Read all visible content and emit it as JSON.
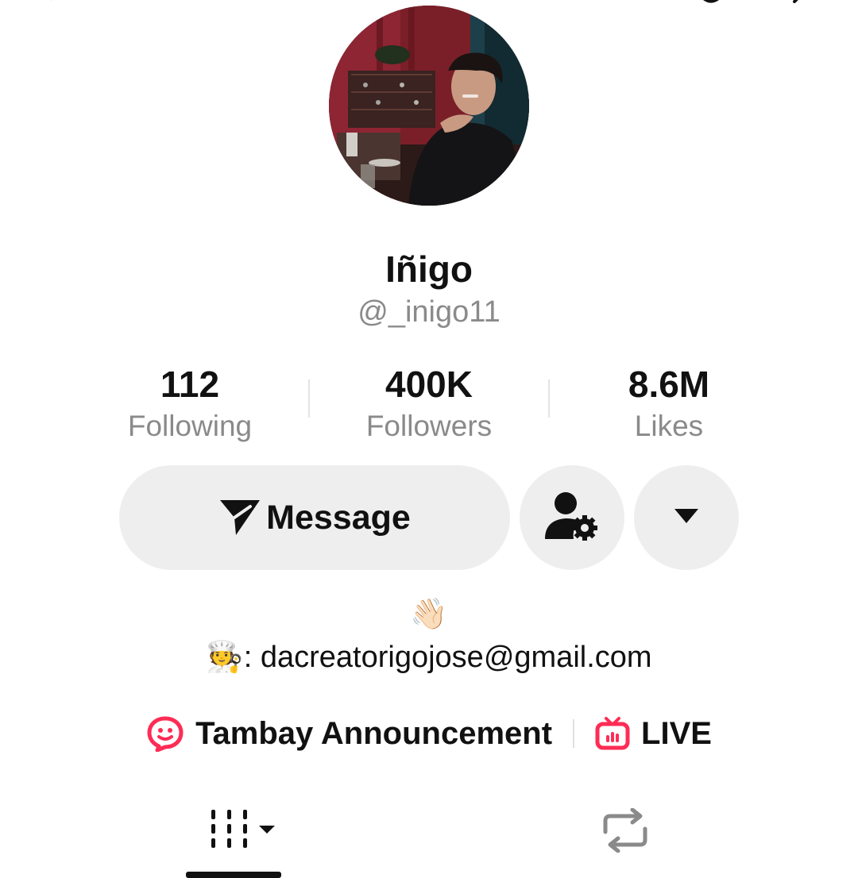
{
  "profile": {
    "display_name": "Iñigo",
    "handle": "@_inigo11"
  },
  "stats": [
    {
      "value": "112",
      "label": "Following"
    },
    {
      "value": "400K",
      "label": "Followers"
    },
    {
      "value": "8.6M",
      "label": "Likes"
    }
  ],
  "actions": {
    "message_label": "Message"
  },
  "bio": {
    "wave_emoji": "👋🏻",
    "chef_emoji": "🧑‍🍳",
    "contact_text": ": dacreatorigojose@gmail.com"
  },
  "links": {
    "announcement_label": "Tambay Announcement",
    "live_label": "LIVE"
  },
  "colors": {
    "accent": "#fe2c55",
    "button_bg": "#eeeeee",
    "muted_text": "#8a8a8a"
  },
  "icons": [
    "back-icon",
    "send-icon",
    "add-friend-settings-icon",
    "dropdown-icon",
    "chat-bubble-icon",
    "live-tv-icon",
    "grid-icon",
    "repost-icon"
  ]
}
